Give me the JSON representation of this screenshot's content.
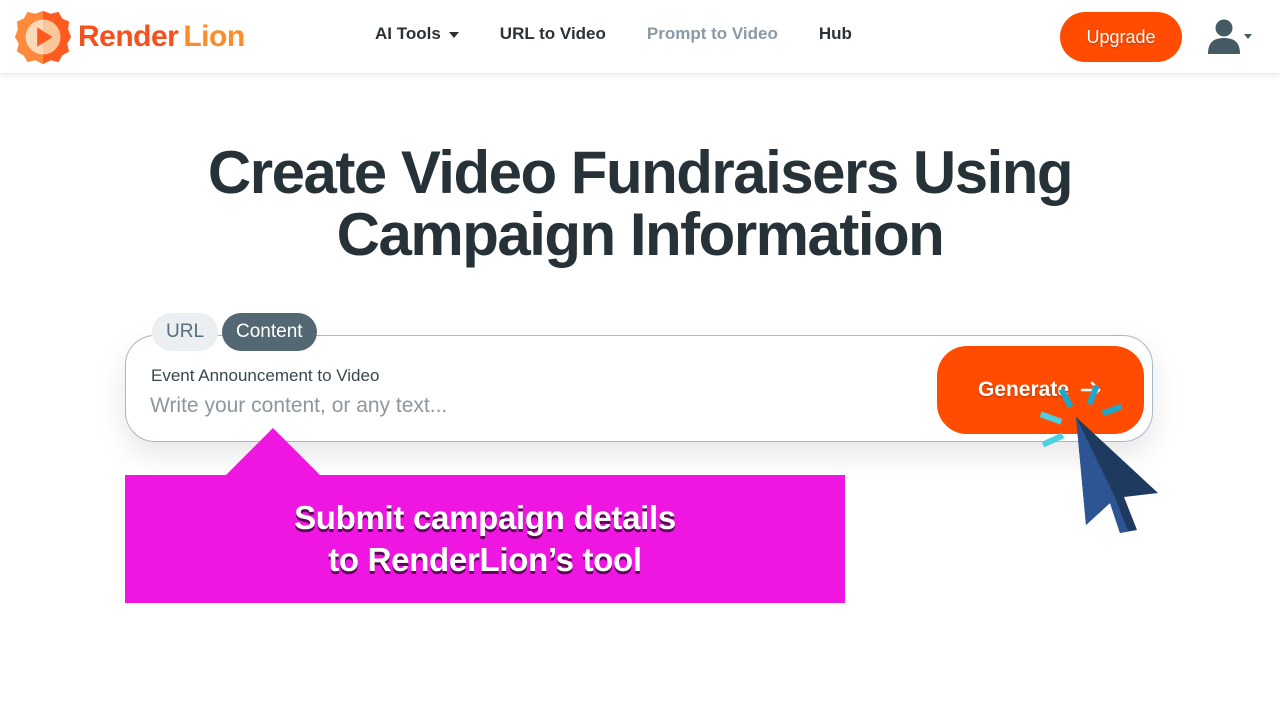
{
  "brand": {
    "name_part1": "Render",
    "name_part2": "Lion",
    "logo_icon": "lion-play-icon",
    "primary_color": "#ff4c00",
    "secondary_color": "#fb8c2a"
  },
  "nav": {
    "items": [
      {
        "label": "AI Tools",
        "has_dropdown": true,
        "muted": false
      },
      {
        "label": "URL to Video",
        "has_dropdown": false,
        "muted": false
      },
      {
        "label": "Prompt to Video",
        "has_dropdown": false,
        "muted": true
      },
      {
        "label": "Hub",
        "has_dropdown": false,
        "muted": false
      }
    ],
    "upgrade_label": "Upgrade",
    "user_icon": "user-icon"
  },
  "hero": {
    "title_line1": "Create Video Fundraisers Using",
    "title_line2": "Campaign Information"
  },
  "input_card": {
    "tabs": [
      {
        "label": "URL",
        "active": false
      },
      {
        "label": "Content",
        "active": true
      }
    ],
    "label": "Event Announcement to Video",
    "value": "",
    "placeholder": "Write your content, or any text...",
    "generate_label": "Generate",
    "generate_icon": "arrow-right-icon"
  },
  "callout": {
    "line1": "Submit campaign details",
    "line2": "to RenderLion’s tool",
    "color": "#ee16e0"
  },
  "overlay": {
    "cursor_icon": "mouse-pointer-icon",
    "click_burst_color": "#26c6da"
  }
}
